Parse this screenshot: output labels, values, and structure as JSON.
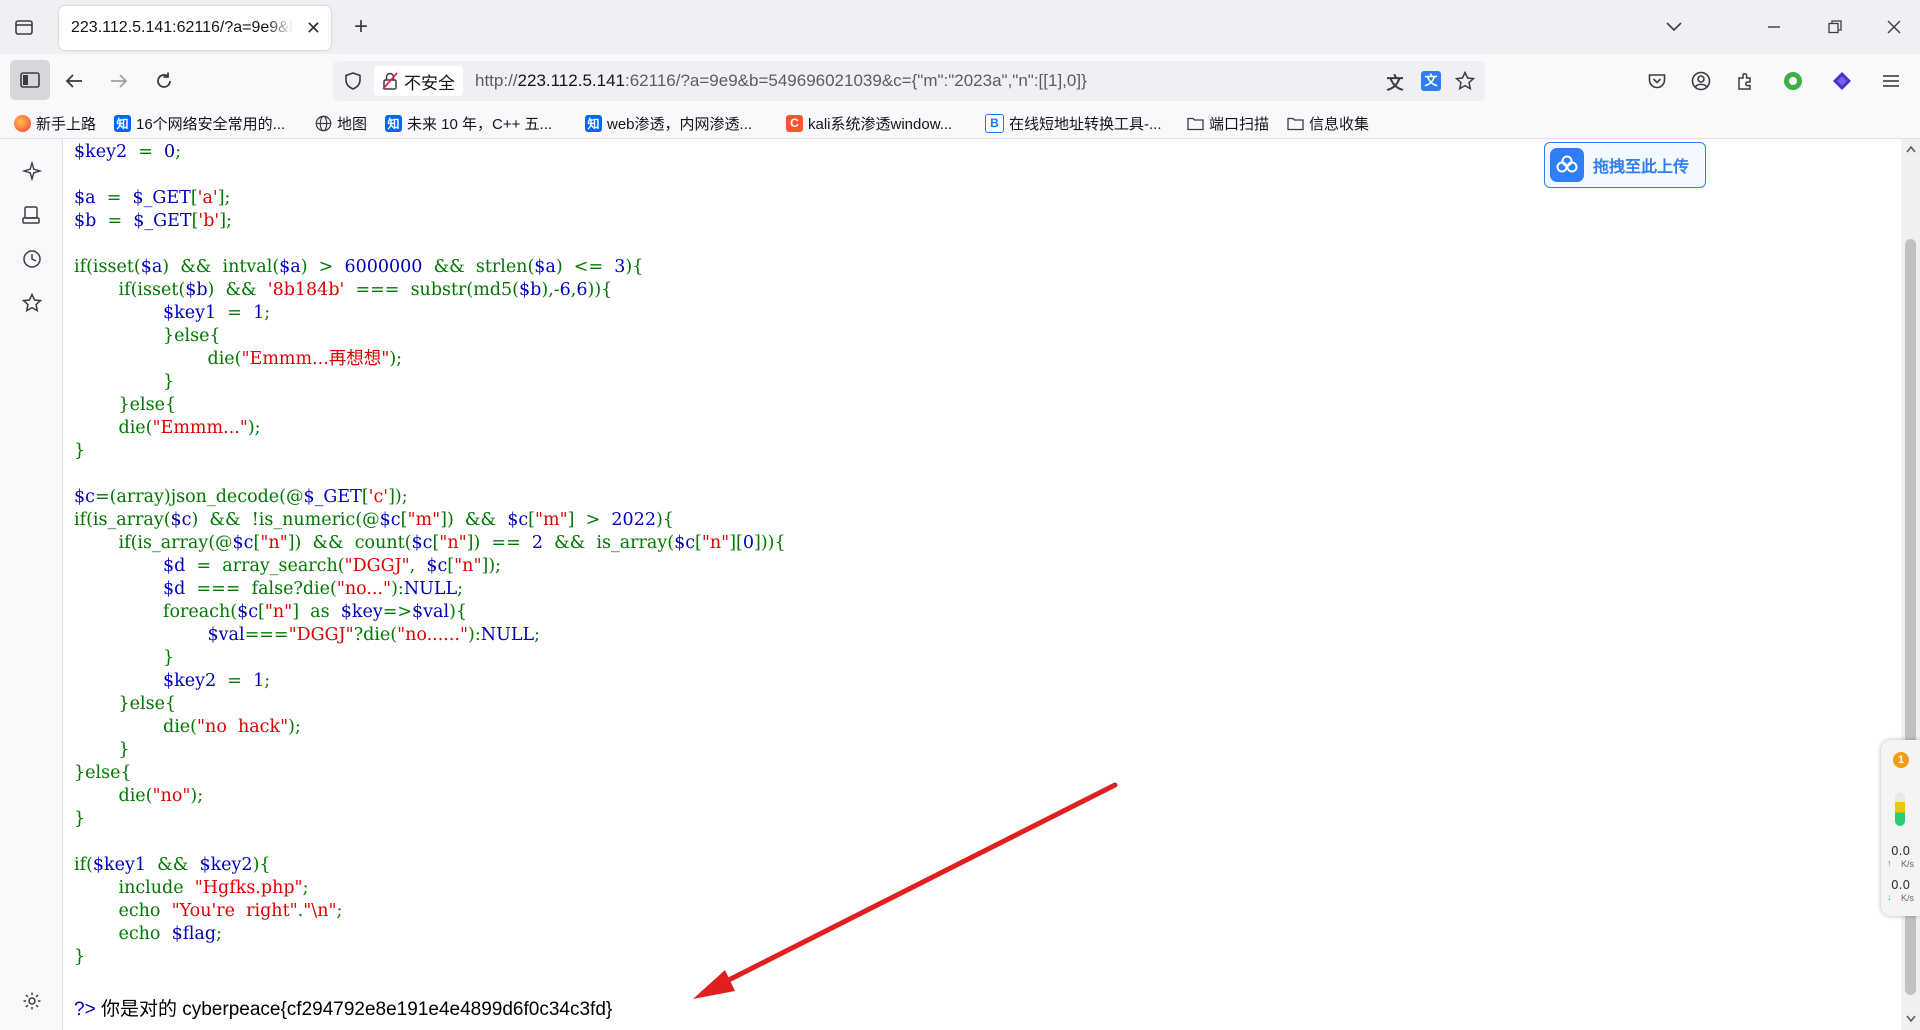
{
  "browser": {
    "tab_title": "223.112.5.141:62116/?a=9e9&b=549696021039",
    "insecure_label": "不安全",
    "url_prefix": "http://",
    "url_host": "223.112.5.141",
    "url_rest": ":62116/?a=9e9&b=549696021039&c={\"m\":\"2023a\",\"n\":[[1],0]}"
  },
  "bookmarks": [
    {
      "label": "新手上路",
      "icon": "firefox-icon",
      "color": "#ff7139"
    },
    {
      "label": "16个网络安全常用的...",
      "icon": "zhihu-icon",
      "color": "#0066ff"
    },
    {
      "label": "地图",
      "icon": "globe-icon",
      "color": "#555555"
    },
    {
      "label": "未来 10 年，C++ 五...",
      "icon": "zhihu-icon",
      "color": "#0066ff"
    },
    {
      "label": "web渗透，内网渗透...",
      "icon": "zhihu-icon",
      "color": "#0066ff"
    },
    {
      "label": "kali系统渗透window...",
      "icon": "csdn-icon",
      "color": "#fc5531"
    },
    {
      "label": "在线短地址转换工具-...",
      "icon": "b-icon",
      "color": "#1677ff"
    },
    {
      "label": "端口扫描",
      "icon": "folder-icon",
      "color": "#555555"
    },
    {
      "label": "信息收集",
      "icon": "folder-icon",
      "color": "#555555"
    }
  ],
  "upload_button": {
    "label": "拖拽至此上传"
  },
  "code_lines": [
    [
      [
        "v",
        "$key2"
      ],
      [
        "k",
        "  =  "
      ],
      [
        "v",
        "0"
      ],
      [
        "k",
        ";"
      ]
    ],
    [],
    [
      [
        "v",
        "$a"
      ],
      [
        "k",
        "  =  "
      ],
      [
        "v",
        "$_GET"
      ],
      [
        "k",
        "["
      ],
      [
        "s",
        "'a'"
      ],
      [
        "k",
        "];"
      ]
    ],
    [
      [
        "v",
        "$b"
      ],
      [
        "k",
        "  =  "
      ],
      [
        "v",
        "$_GET"
      ],
      [
        "k",
        "["
      ],
      [
        "s",
        "'b'"
      ],
      [
        "k",
        "];"
      ]
    ],
    [],
    [
      [
        "k",
        "if(isset("
      ],
      [
        "v",
        "$a"
      ],
      [
        "k",
        ")  &&  intval("
      ],
      [
        "v",
        "$a"
      ],
      [
        "k",
        ")  >  "
      ],
      [
        "v",
        "6000000"
      ],
      [
        "k",
        "  &&  strlen("
      ],
      [
        "v",
        "$a"
      ],
      [
        "k",
        ")  <=  "
      ],
      [
        "v",
        "3"
      ],
      [
        "k",
        "){"
      ]
    ],
    [
      [
        "k",
        "        if(isset("
      ],
      [
        "v",
        "$b"
      ],
      [
        "k",
        ")  &&  "
      ],
      [
        "s",
        "'8b184b'"
      ],
      [
        "k",
        "  ===  substr(md5("
      ],
      [
        "v",
        "$b"
      ],
      [
        "k",
        "),-"
      ],
      [
        "v",
        "6"
      ],
      [
        "k",
        ","
      ],
      [
        "v",
        "6"
      ],
      [
        "k",
        "))"
      ],
      [
        "k",
        "{"
      ]
    ],
    [
      [
        "k",
        "                "
      ],
      [
        "v",
        "$key1"
      ],
      [
        "k",
        "  =  "
      ],
      [
        "v",
        "1"
      ],
      [
        "k",
        ";"
      ]
    ],
    [
      [
        "k",
        "                }else{"
      ]
    ],
    [
      [
        "k",
        "                        die("
      ],
      [
        "s",
        "\"Emmm...再想想\""
      ],
      [
        "k",
        ");"
      ]
    ],
    [
      [
        "k",
        "                }"
      ]
    ],
    [
      [
        "k",
        "        }else{"
      ]
    ],
    [
      [
        "k",
        "        die("
      ],
      [
        "s",
        "\"Emmm...\""
      ],
      [
        "k",
        ");"
      ]
    ],
    [
      [
        "k",
        "}"
      ]
    ],
    [],
    [
      [
        "v",
        "$c"
      ],
      [
        "k",
        "=(array)json_decode(@"
      ],
      [
        "v",
        "$_GET"
      ],
      [
        "k",
        "["
      ],
      [
        "s",
        "'c'"
      ],
      [
        "k",
        "]);"
      ]
    ],
    [
      [
        "k",
        "if(is_array("
      ],
      [
        "v",
        "$c"
      ],
      [
        "k",
        ")  &&  !is_numeric(@"
      ],
      [
        "v",
        "$c"
      ],
      [
        "k",
        "["
      ],
      [
        "s",
        "\"m\""
      ],
      [
        "k",
        "])  &&  "
      ],
      [
        "v",
        "$c"
      ],
      [
        "k",
        "["
      ],
      [
        "s",
        "\"m\""
      ],
      [
        "k",
        "]  >  "
      ],
      [
        "v",
        "2022"
      ],
      [
        "k",
        "){"
      ]
    ],
    [
      [
        "k",
        "        if(is_array(@"
      ],
      [
        "v",
        "$c"
      ],
      [
        "k",
        "["
      ],
      [
        "s",
        "\"n\""
      ],
      [
        "k",
        "])  &&  count("
      ],
      [
        "v",
        "$c"
      ],
      [
        "k",
        "["
      ],
      [
        "s",
        "\"n\""
      ],
      [
        "k",
        "])  ==  "
      ],
      [
        "v",
        "2"
      ],
      [
        "k",
        "  &&  is_array("
      ],
      [
        "v",
        "$c"
      ],
      [
        "k",
        "["
      ],
      [
        "s",
        "\"n\""
      ],
      [
        "k",
        "]["
      ],
      [
        "v",
        "0"
      ],
      [
        "k",
        "])){"
      ]
    ],
    [
      [
        "k",
        "                "
      ],
      [
        "v",
        "$d"
      ],
      [
        "k",
        "  =  array_search("
      ],
      [
        "s",
        "\"DGGJ\""
      ],
      [
        "k",
        ",  "
      ],
      [
        "v",
        "$c"
      ],
      [
        "k",
        "["
      ],
      [
        "s",
        "\"n\""
      ],
      [
        "k",
        "]);"
      ]
    ],
    [
      [
        "k",
        "                "
      ],
      [
        "v",
        "$d"
      ],
      [
        "k",
        "  ===  false?die("
      ],
      [
        "s",
        "\"no...\""
      ],
      [
        "k",
        "):"
      ],
      [
        "v",
        "NULL"
      ],
      [
        "k",
        ";"
      ]
    ],
    [
      [
        "k",
        "                foreach("
      ],
      [
        "v",
        "$c"
      ],
      [
        "k",
        "["
      ],
      [
        "s",
        "\"n\""
      ],
      [
        "k",
        "]  as  "
      ],
      [
        "v",
        "$key"
      ],
      [
        "k",
        "=>"
      ],
      [
        "v",
        "$val"
      ],
      [
        "k",
        "){"
      ]
    ],
    [
      [
        "k",
        "                        "
      ],
      [
        "v",
        "$val"
      ],
      [
        "k",
        "==="
      ],
      [
        "s",
        "\"DGGJ\""
      ],
      [
        "k",
        "?die("
      ],
      [
        "s",
        "\"no......\""
      ],
      [
        "k",
        "):"
      ],
      [
        "v",
        "NULL"
      ],
      [
        "k",
        ";"
      ]
    ],
    [
      [
        "k",
        "                }"
      ]
    ],
    [
      [
        "k",
        "                "
      ],
      [
        "v",
        "$key2"
      ],
      [
        "k",
        "  =  "
      ],
      [
        "v",
        "1"
      ],
      [
        "k",
        ";"
      ]
    ],
    [
      [
        "k",
        "        }else{"
      ]
    ],
    [
      [
        "k",
        "                die("
      ],
      [
        "s",
        "\"no  hack\""
      ],
      [
        "k",
        ");"
      ]
    ],
    [
      [
        "k",
        "        }"
      ]
    ],
    [
      [
        "k",
        "}else{"
      ]
    ],
    [
      [
        "k",
        "        die("
      ],
      [
        "s",
        "\"no\""
      ],
      [
        "k",
        ");"
      ]
    ],
    [
      [
        "k",
        "}"
      ]
    ],
    [],
    [
      [
        "k",
        "if("
      ],
      [
        "v",
        "$key1"
      ],
      [
        "k",
        "  &&  "
      ],
      [
        "v",
        "$key2"
      ],
      [
        "k",
        "){"
      ]
    ],
    [
      [
        "k",
        "        include  "
      ],
      [
        "s",
        "\"Hgfks.php\""
      ],
      [
        "k",
        ";"
      ]
    ],
    [
      [
        "k",
        "        echo  "
      ],
      [
        "s",
        "\"You're  right\""
      ],
      [
        "k",
        "."
      ],
      [
        "s",
        "\"\\n\""
      ],
      [
        "k",
        ";"
      ]
    ],
    [
      [
        "k",
        "        echo  "
      ],
      [
        "v",
        "$flag"
      ],
      [
        "k",
        ";"
      ]
    ],
    [
      [
        "k",
        "}"
      ]
    ]
  ],
  "result": {
    "prompt": "?>",
    "text": "你是对的 cyberpeace{cf294792e8e191e4e4899d6f0c34c3fd}"
  },
  "net_widget": {
    "badge": "1",
    "up_speed": "0.0",
    "down_speed": "0.0",
    "unit": "K/s"
  },
  "colors": {
    "annotation_arrow": "#e02020",
    "php_var": "#0000bb",
    "php_keyword": "#007700",
    "php_string": "#dd0000"
  }
}
